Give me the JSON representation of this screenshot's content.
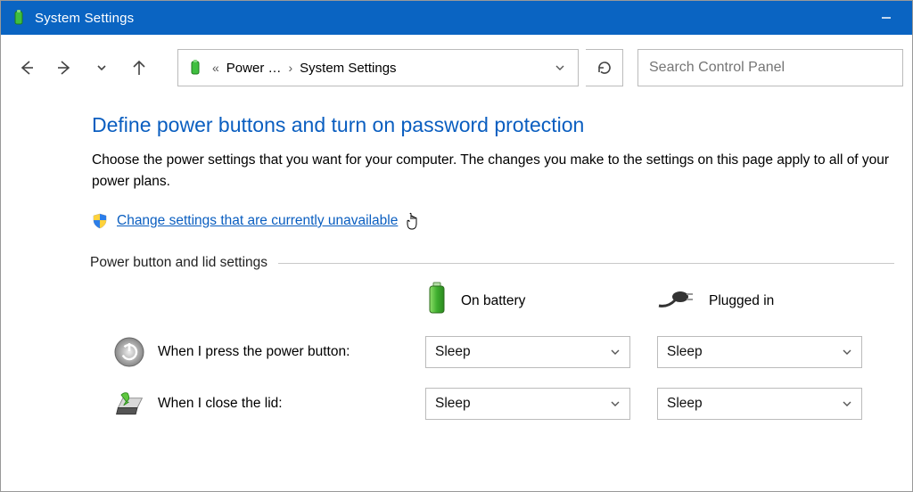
{
  "window": {
    "title": "System Settings"
  },
  "breadcrumb": {
    "back_sep": "«",
    "level1": "Power …",
    "sep": "›",
    "level2": "System Settings"
  },
  "search": {
    "placeholder": "Search Control Panel"
  },
  "page": {
    "heading": "Define power buttons and turn on password protection",
    "description": "Choose the power settings that you want for your computer. The changes you make to the settings on this page apply to all of your power plans.",
    "change_link": "Change settings that are currently unavailable",
    "group_label": "Power button and lid settings",
    "columns": {
      "battery": "On battery",
      "plugged": "Plugged in"
    },
    "rows": [
      {
        "label": "When I press the power button:",
        "battery_value": "Sleep",
        "plugged_value": "Sleep"
      },
      {
        "label": "When I close the lid:",
        "battery_value": "Sleep",
        "plugged_value": "Sleep"
      }
    ]
  }
}
